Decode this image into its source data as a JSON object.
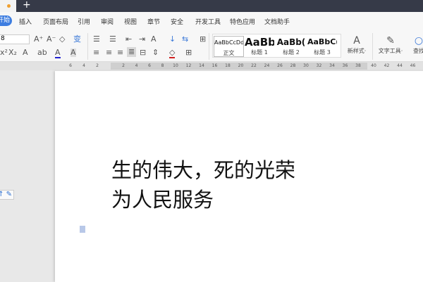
{
  "tabbar": {
    "new_tab": "+"
  },
  "menu": {
    "items": [
      "开始",
      "插入",
      "页面布局",
      "引用",
      "审阅",
      "视图",
      "章节",
      "安全",
      "开发工具",
      "特色应用",
      "文档助手"
    ]
  },
  "toolbar": {
    "font_size": "8",
    "styles": [
      {
        "sample": "AaBbCcDd",
        "label": "正文"
      },
      {
        "sample": "AaBb",
        "label": "标题 1"
      },
      {
        "sample": "AaBb(",
        "label": "标题 2"
      },
      {
        "sample": "AaBbC(",
        "label": "标题 3"
      }
    ],
    "new_style": "新样式·",
    "text_tools": "文字工具·",
    "find": "查找"
  },
  "ruler": {
    "left_ticks": [
      "6",
      "4",
      "2"
    ],
    "ticks": [
      "2",
      "4",
      "6",
      "8",
      "10",
      "12",
      "14",
      "16",
      "18",
      "20",
      "22",
      "24",
      "26",
      "28",
      "30",
      "32",
      "34",
      "36",
      "38"
    ],
    "right_ticks": [
      "40",
      "42",
      "44",
      "46"
    ]
  },
  "document": {
    "lines": [
      "生的伟大，死的光荣",
      "为人民服务"
    ]
  }
}
